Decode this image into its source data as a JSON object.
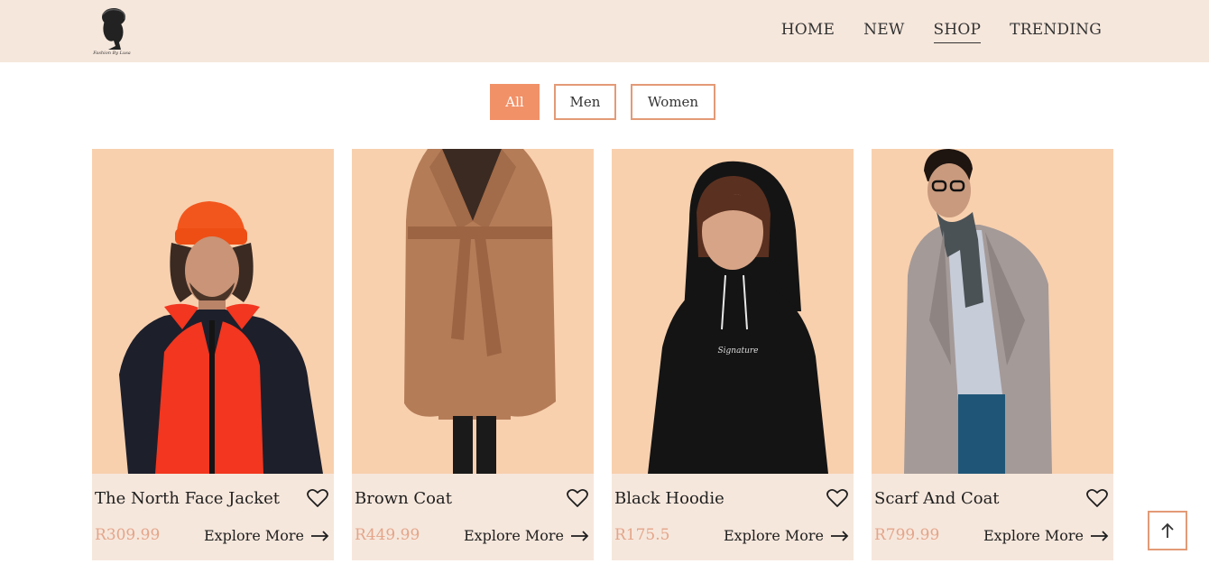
{
  "header": {
    "logo_icon": "fashion-logo-icon",
    "nav": [
      {
        "label": "HOME",
        "active": false
      },
      {
        "label": "NEW",
        "active": false
      },
      {
        "label": "SHOP",
        "active": true
      },
      {
        "label": "TRENDING",
        "active": false
      }
    ]
  },
  "filters": [
    {
      "label": "All",
      "active": true
    },
    {
      "label": "Men",
      "active": false
    },
    {
      "label": "Women",
      "active": false
    }
  ],
  "products": [
    {
      "name": "The North Face Jacket",
      "price": "R309.99",
      "cta": "Explore More"
    },
    {
      "name": "Brown Coat",
      "price": "R449.99",
      "cta": "Explore More"
    },
    {
      "name": "Black Hoodie",
      "price": "R175.5",
      "cta": "Explore More"
    },
    {
      "name": "Scarf And Coat",
      "price": "R799.99",
      "cta": "Explore More"
    }
  ],
  "colors": {
    "header_bg": "#f6e7dc",
    "accent": "#f19168",
    "card_bg": "#f6e7dc",
    "image_bg": "#f8d0ae",
    "price": "#e4a58a"
  },
  "scroll_top_icon": "arrow-up-icon"
}
